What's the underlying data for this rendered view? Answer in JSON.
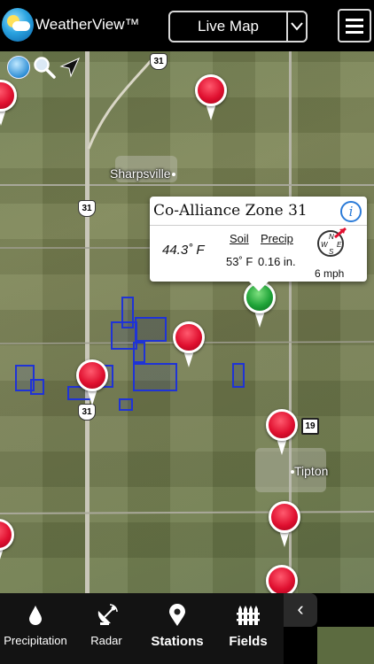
{
  "header": {
    "app_title": "WeatherView™",
    "mode_select": {
      "selected": "Live Map",
      "arrow": "∨"
    },
    "menu_icon": "hamburger-icon"
  },
  "map": {
    "tools": [
      "globe-icon",
      "magnifier-icon",
      "location-arrow-icon"
    ],
    "places": [
      {
        "name": "Sharpsville"
      },
      {
        "name": "Tipton"
      }
    ],
    "route_shields": [
      "31",
      "31",
      "31",
      "19"
    ],
    "stations": {
      "red_count": 8,
      "green_count": 1
    }
  },
  "callout": {
    "title": "Co-Alliance Zone 31",
    "info_icon": "i",
    "air_temp": "44.3˚ F",
    "soil_label": "Soil",
    "precip_label": "Precip",
    "soil_value": "53˚ F",
    "precip_value": "0.16 in.",
    "compass": {
      "n": "N",
      "e": "E",
      "s": "S",
      "w": "W"
    },
    "wind_speed": "6 mph"
  },
  "tabbar": {
    "collapse_glyph": "‹",
    "tabs": [
      {
        "label": "Precipitation",
        "icon": "raindrop-icon"
      },
      {
        "label": "Radar",
        "icon": "satellite-dish-icon"
      },
      {
        "label": "Stations",
        "icon": "map-pin-icon",
        "active": true
      },
      {
        "label": "Fields",
        "icon": "fence-icon"
      }
    ]
  },
  "colors": {
    "header_bg": "#000000",
    "pin_red": "#e01030",
    "pin_green": "#1fa338",
    "parcel_blue": "#1f33d6",
    "info_blue": "#2b7bd8"
  }
}
